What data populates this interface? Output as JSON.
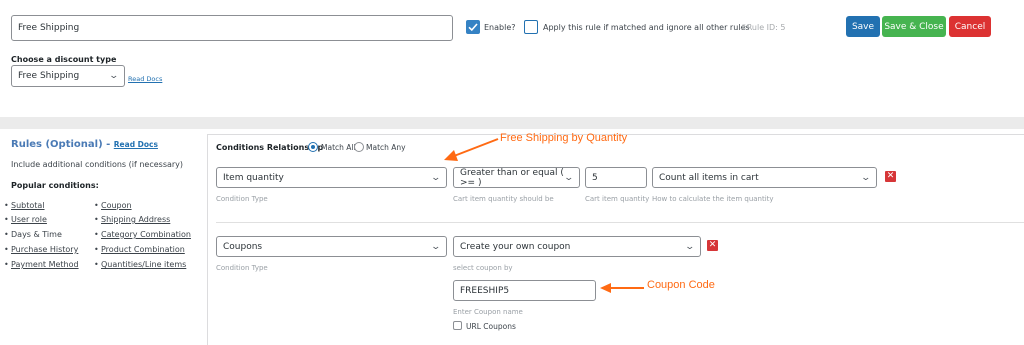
{
  "header": {
    "rule_name_value": "Free Shipping",
    "enable_label": "Enable?",
    "apply_only_label": "Apply this rule if matched and ignore all other rules",
    "rule_id_label": "#Rule ID: 5",
    "save_label": "Save",
    "save_close_label": "Save & Close",
    "cancel_label": "Cancel"
  },
  "discount_type": {
    "heading": "Choose a discount type",
    "selected": "Free Shipping",
    "read_docs": "Read Docs"
  },
  "sidebar": {
    "title": "Rules (Optional)",
    "title_separator": "-",
    "read_docs": "Read Docs",
    "subtitle": "Include additional conditions (if necessary)",
    "popular_heading": "Popular conditions:",
    "left_items": [
      {
        "label": "Subtotal",
        "link": true
      },
      {
        "label": "User role",
        "link": true
      },
      {
        "label": "Days & Time",
        "link": false
      },
      {
        "label": "Purchase History",
        "link": true
      },
      {
        "label": "Payment Method",
        "link": true
      }
    ],
    "right_items": [
      {
        "label": "Coupon",
        "link": true
      },
      {
        "label": "Shipping Address",
        "link": true
      },
      {
        "label": "Category Combination",
        "link": true
      },
      {
        "label": "Product Combination",
        "link": true
      },
      {
        "label": "Quantities/Line items",
        "link": true
      }
    ]
  },
  "conditions": {
    "relationship_label": "Conditions Relationship",
    "match_all_label": "Match All",
    "match_any_label": "Match Any",
    "row1": {
      "type_value": "Item quantity",
      "type_hint": "Condition Type",
      "operator_value": "Greater than or equal ( >= )",
      "operator_hint": "Cart item quantity should be",
      "quantity_value": "5",
      "quantity_hint": "Cart item quantity",
      "count_value": "Count all items in cart",
      "count_hint": "How to calculate the item quantity"
    },
    "row2": {
      "type_value": "Coupons",
      "type_hint": "Condition Type",
      "coupon_mode_value": "Create your own coupon",
      "coupon_mode_hint": "select coupon by",
      "coupon_code_value": "FREESHIP5",
      "coupon_code_hint": "Enter Coupon name",
      "url_coupons_label": "URL Coupons"
    }
  },
  "annotations": {
    "free_shipping_qty": "Free Shipping by Quantity",
    "coupon_code": "Coupon Code",
    "color": "#ff6a13"
  },
  "colors": {
    "save": "#2271b1",
    "save_close": "#46b450",
    "cancel": "#dc3232",
    "accent_blue": "#2271b1"
  },
  "icons": {
    "delete": "close-icon",
    "dropdown": "chevron-down-icon",
    "checkbox_checked": "check-icon"
  },
  "x_glyph": "✕",
  "check_glyph": "✓",
  "chev_glyph": "⌄"
}
